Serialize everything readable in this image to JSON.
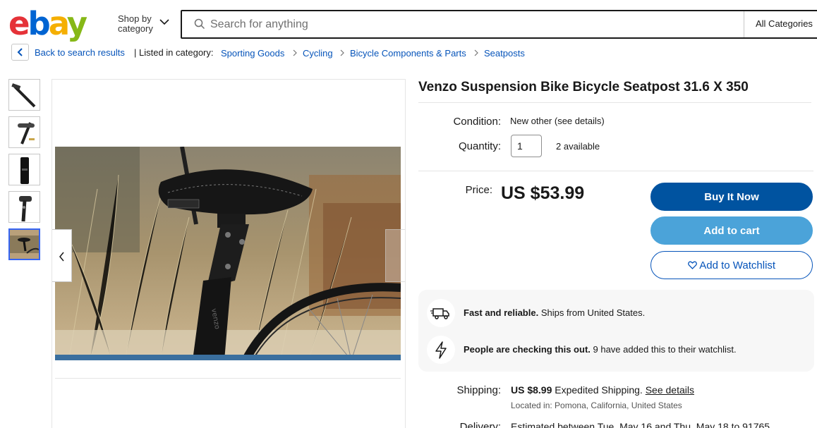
{
  "header": {
    "logo": {
      "e": "e",
      "b": "b",
      "a": "a",
      "y": "y"
    },
    "shop_by": "Shop by",
    "category": "category",
    "search_placeholder": "Search for anything",
    "category_select": "All Categories"
  },
  "breadcrumb": {
    "back": "Back to search results",
    "listed_in": "| Listed in category:",
    "items": [
      "Sporting Goods",
      "Cycling",
      "Bicycle Components & Parts",
      "Seatposts"
    ]
  },
  "gallery": {
    "thumbnail_count": 5,
    "active_index": 4
  },
  "item": {
    "title": "Venzo Suspension Bike Bicycle Seatpost 31.6 X 350",
    "condition_label": "Condition:",
    "condition_value": "New other (see details)",
    "quantity_label": "Quantity:",
    "quantity_value": "1",
    "available": "2 available",
    "price_label": "Price:",
    "price": "US $53.99"
  },
  "buttons": {
    "buy": "Buy It Now",
    "cart": "Add to cart",
    "watch": "Add to Watchlist"
  },
  "info": [
    {
      "bold": "Fast and reliable.",
      "text": " Ships from United States.",
      "icon": "truck-icon"
    },
    {
      "bold": "People are checking this out.",
      "text": " 9 have added this to their watchlist.",
      "icon": "lightning-icon"
    }
  ],
  "shipping": {
    "label": "Shipping:",
    "price": "US $8.99",
    "method": " Expedited Shipping. ",
    "details_link": "See details",
    "location": "Located in: Pomona, California, United States"
  },
  "delivery": {
    "label": "Delivery:",
    "text": "Estimated between Tue. May 16 and Thu. May 18 to 91765"
  },
  "colors": {
    "brand_blue": "#0053a0",
    "cart_blue": "#4ba3d9",
    "link_blue": "#0654ba",
    "active_thumb": "#3665f3"
  }
}
